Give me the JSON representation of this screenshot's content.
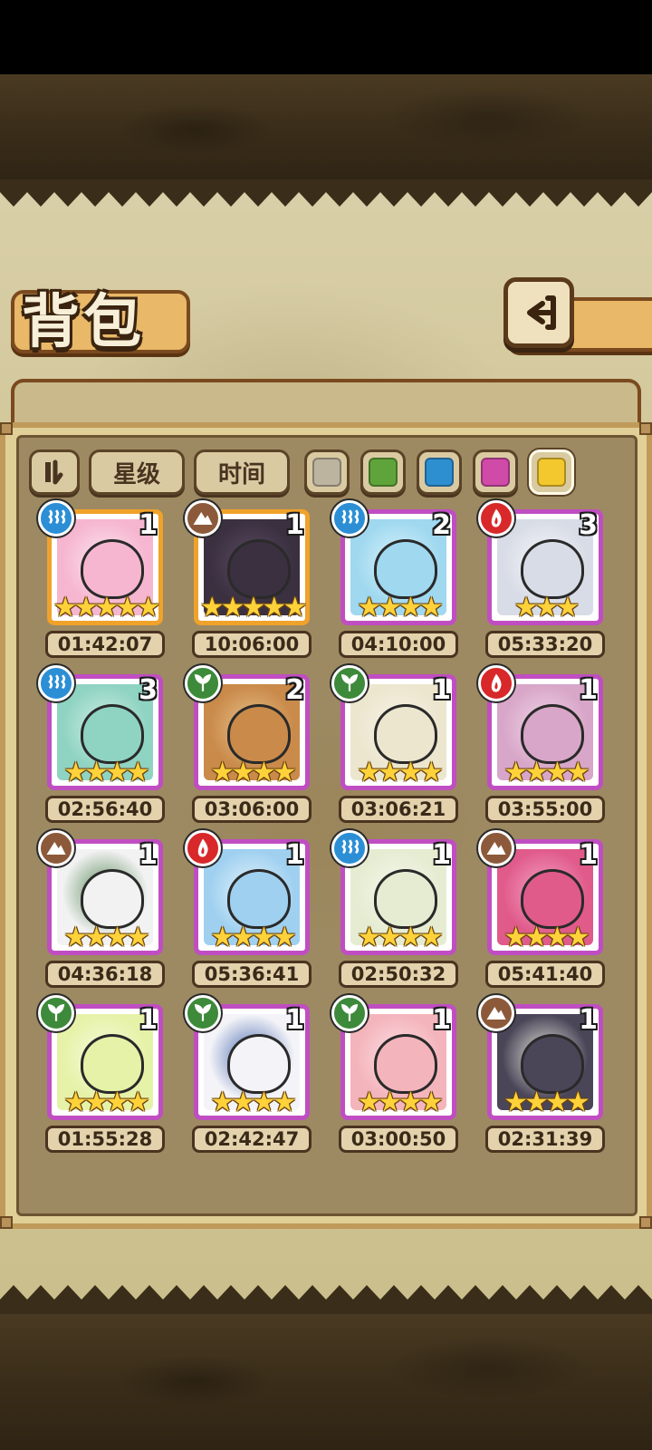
{
  "title": "背包",
  "filters": {
    "star_label": "星级",
    "time_label": "时间"
  },
  "colors": {
    "gray": "#bdb4a0",
    "green": "#5fa43a",
    "blue": "#2e8fd0",
    "pink": "#d04aa8",
    "yellow": "#f3c82e",
    "water": "#2c8fd6",
    "earth": "#8c5a3a",
    "fire": "#d8282a",
    "grass": "#3d8a3a",
    "purple_frame": "#c04ec2",
    "gold_frame": "#f0a22a"
  },
  "items": [
    {
      "element": "water",
      "count": "1",
      "stars": "★★★★★",
      "time": "01:42:07",
      "frame": "gold",
      "art": "pink-egg"
    },
    {
      "element": "earth",
      "count": "1",
      "stars": "★★★★★",
      "time": "10:06:00",
      "frame": "gold",
      "art": "coffin"
    },
    {
      "element": "water",
      "count": "2",
      "stars": "★★★★",
      "time": "04:10:00",
      "frame": "purple",
      "art": "water-slime"
    },
    {
      "element": "fire",
      "count": "3",
      "stars": "★★★",
      "time": "05:33:20",
      "frame": "purple",
      "art": "dagger"
    },
    {
      "element": "water",
      "count": "3",
      "stars": "★★★★",
      "time": "02:56:40",
      "frame": "purple",
      "art": "ghost-shell"
    },
    {
      "element": "grass",
      "count": "2",
      "stars": "★★★★",
      "time": "03:06:00",
      "frame": "purple",
      "art": "tiger-egg"
    },
    {
      "element": "grass",
      "count": "1",
      "stars": "★★★★",
      "time": "03:06:21",
      "frame": "purple",
      "art": "bird-egg"
    },
    {
      "element": "fire",
      "count": "1",
      "stars": "★★★★",
      "time": "03:55:00",
      "frame": "purple",
      "art": "bat-egg"
    },
    {
      "element": "earth",
      "count": "1",
      "stars": "★★★★",
      "time": "04:36:18",
      "frame": "purple",
      "art": "panda-egg"
    },
    {
      "element": "fire",
      "count": "1",
      "stars": "★★★★",
      "time": "05:36:41",
      "frame": "purple",
      "art": "ice-crystal"
    },
    {
      "element": "water",
      "count": "1",
      "stars": "★★★★",
      "time": "02:50:32",
      "frame": "purple",
      "art": "leaf-egg"
    },
    {
      "element": "earth",
      "count": "1",
      "stars": "★★★★",
      "time": "05:41:40",
      "frame": "purple",
      "art": "thorn-egg"
    },
    {
      "element": "grass",
      "count": "1",
      "stars": "★★★★",
      "time": "01:55:28",
      "frame": "purple",
      "art": "sprout-egg"
    },
    {
      "element": "grass",
      "count": "1",
      "stars": "★★★★",
      "time": "02:42:47",
      "frame": "purple",
      "art": "feather-egg"
    },
    {
      "element": "grass",
      "count": "1",
      "stars": "★★★★",
      "time": "03:00:50",
      "frame": "purple",
      "art": "pig-egg"
    },
    {
      "element": "earth",
      "count": "1",
      "stars": "★★★★",
      "time": "02:31:39",
      "frame": "purple",
      "art": "mole-egg"
    }
  ]
}
